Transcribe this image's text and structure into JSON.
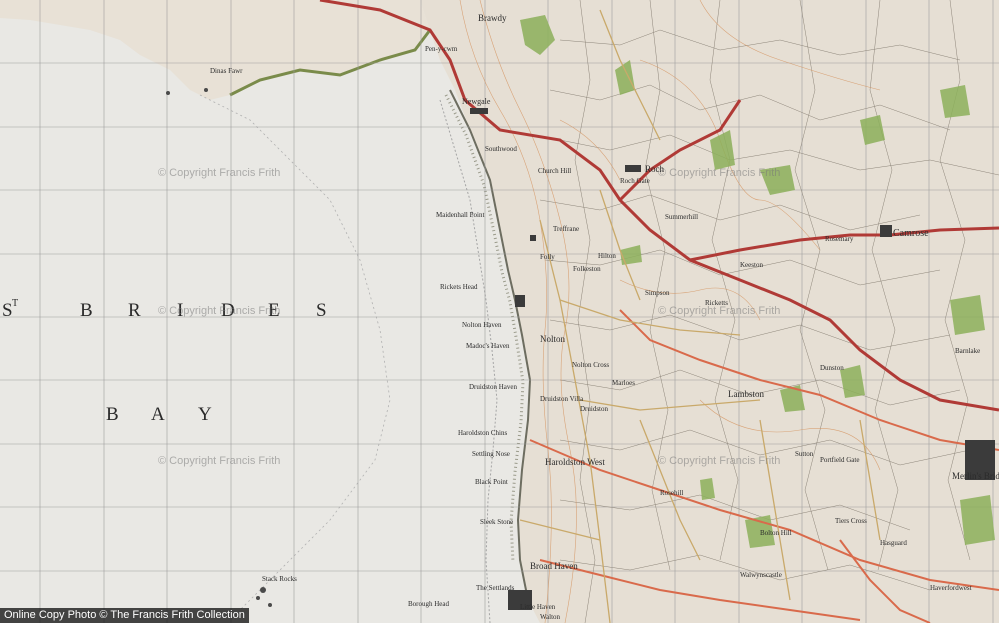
{
  "map": {
    "sea_title": {
      "letters": [
        "S",
        "T",
        "B",
        "R",
        "I",
        "D",
        "E",
        "S"
      ],
      "bay": [
        "B",
        "A",
        "Y"
      ]
    },
    "watermarks": [
      "© Copyright Francis Frith",
      "© Copyright Francis Frith",
      "© Copyright Francis Frith",
      "© Copyright Francis Frith",
      "© Copyright Francis Frith",
      "© Copyright Francis Frith"
    ],
    "places": [
      "Brawdy",
      "Pen-y-cwm",
      "Newgale",
      "Southwood",
      "Church Hill",
      "Roch",
      "Roch Gate",
      "Summerhill",
      "Camrose",
      "Maidenhall Point",
      "Treffrane",
      "Hilton",
      "Folly",
      "Folkeston",
      "Rickets Head",
      "Nolton Haven",
      "Nolton",
      "Nolton Cross",
      "Madoc's Haven",
      "Simpson",
      "Druidston Haven",
      "Druidston Villa",
      "Druidston",
      "Marloes",
      "Haroldston Chins",
      "Haroldston West",
      "Settling Nose",
      "Black Point",
      "Sleek Stone",
      "Broad Haven",
      "The Settlands",
      "Lambston",
      "Barnlake",
      "Merlin's Bridge",
      "Haverfordwest",
      "Little Haven",
      "Walton",
      "Rosemary",
      "Keeston",
      "Dunston",
      "Portfield Gate",
      "Sutton",
      "Hasguard",
      "Walwynscastle",
      "Rosehill",
      "Bolton Hill",
      "Tiers Cross",
      "Stack Rocks",
      "Borough Head",
      "Dinas Fawr",
      "Ricketts"
    ]
  },
  "copyright": "Online Copy Photo  © The Francis Frith Collection"
}
